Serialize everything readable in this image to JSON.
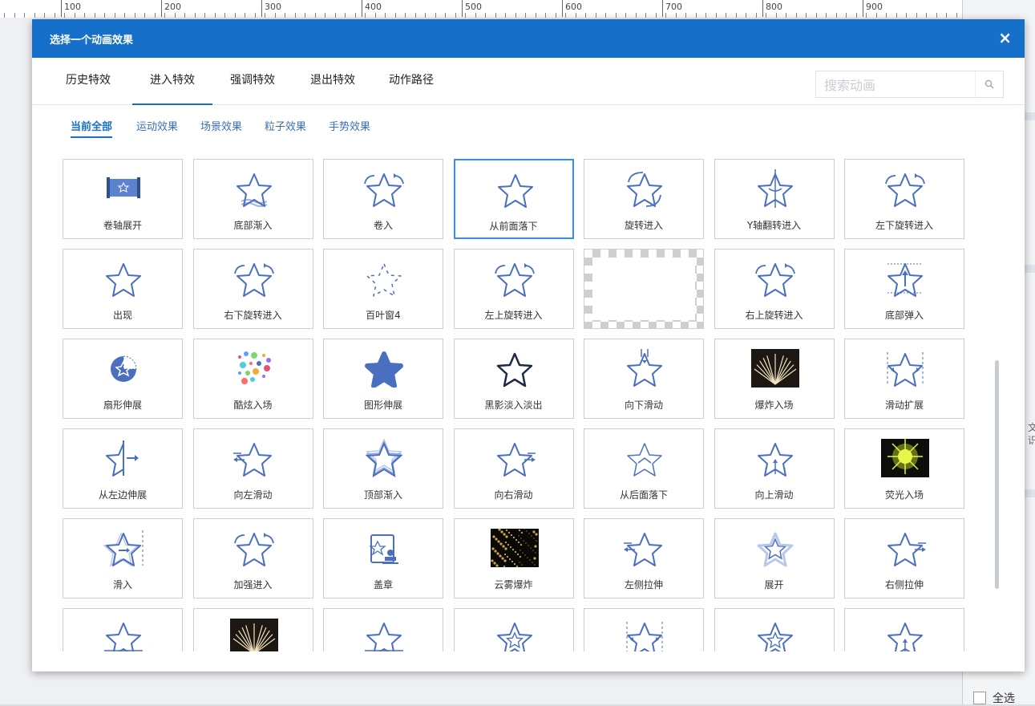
{
  "ruler": {
    "labels": [
      "100",
      "200",
      "300",
      "400",
      "500",
      "600",
      "700",
      "800",
      "900"
    ]
  },
  "background": {
    "select_all": "全选",
    "partial_1": "文",
    "partial_2": "识"
  },
  "dialog": {
    "title": "选择一个动画效果",
    "close_label": "×",
    "tabs": [
      {
        "label": "历史特效"
      },
      {
        "label": "进入特效",
        "active": true
      },
      {
        "label": "强调特效"
      },
      {
        "label": "退出特效"
      },
      {
        "label": "动作路径"
      }
    ],
    "search": {
      "placeholder": "搜索动画",
      "icon": "search-icon"
    },
    "subtabs": [
      {
        "label": "当前全部",
        "active": true
      },
      {
        "label": "运动效果"
      },
      {
        "label": "场景效果"
      },
      {
        "label": "粒子效果"
      },
      {
        "label": "手势效果"
      }
    ],
    "effects": [
      {
        "label": "卷轴展开",
        "icon": "scroll"
      },
      {
        "label": "底部渐入",
        "icon": "star-wave"
      },
      {
        "label": "卷入",
        "icon": "star-swirl"
      },
      {
        "label": "从前面落下",
        "icon": "star",
        "selected": true
      },
      {
        "label": "旋转进入",
        "icon": "star-rotate"
      },
      {
        "label": "Y轴翻转进入",
        "icon": "star-flip"
      },
      {
        "label": "左下旋转进入",
        "icon": "star-swirl"
      },
      {
        "label": "出现",
        "icon": "star"
      },
      {
        "label": "右下旋转进入",
        "icon": "star-swirl"
      },
      {
        "label": "百叶窗4",
        "icon": "star-dashed"
      },
      {
        "label": "左上旋转进入",
        "icon": "star-swirl"
      },
      {
        "label": "",
        "icon": "checker"
      },
      {
        "label": "右上旋转进入",
        "icon": "star-swirl"
      },
      {
        "label": "底部弹入",
        "icon": "star-bounce"
      },
      {
        "label": "扇形伸展",
        "icon": "pie"
      },
      {
        "label": "酷炫入场",
        "icon": "dots"
      },
      {
        "label": "图形伸展",
        "icon": "blob"
      },
      {
        "label": "黑影淡入淡出",
        "icon": "star-dark"
      },
      {
        "label": "向下滑动",
        "icon": "star-down"
      },
      {
        "label": "爆炸入场",
        "icon": "photo-burst"
      },
      {
        "label": "滑动扩展",
        "icon": "star-expand"
      },
      {
        "label": "从左边伸展",
        "icon": "star-half"
      },
      {
        "label": "向左滑动",
        "icon": "star-left"
      },
      {
        "label": "顶部渐入",
        "icon": "star-stack"
      },
      {
        "label": "向右滑动",
        "icon": "star-right"
      },
      {
        "label": "从后面落下",
        "icon": "star-thin"
      },
      {
        "label": "向上滑动",
        "icon": "star-up"
      },
      {
        "label": "荧光入场",
        "icon": "photo-glow"
      },
      {
        "label": "滑入",
        "icon": "star-slide"
      },
      {
        "label": "加强进入",
        "icon": "star-swirl"
      },
      {
        "label": "盖章",
        "icon": "stamp"
      },
      {
        "label": "云雾爆炸",
        "icon": "photo-dark"
      },
      {
        "label": "左侧拉伸",
        "icon": "star-left"
      },
      {
        "label": "展开",
        "icon": "star-double"
      },
      {
        "label": "右侧拉伸",
        "icon": "star-right"
      },
      {
        "label": "",
        "icon": "star-line"
      },
      {
        "label": "",
        "icon": "photo-burst"
      },
      {
        "label": "",
        "icon": "star-line"
      },
      {
        "label": "",
        "icon": "star-inner"
      },
      {
        "label": "",
        "icon": "star-expand"
      },
      {
        "label": "",
        "icon": "star-inner"
      },
      {
        "label": "",
        "icon": "star-up"
      }
    ]
  },
  "colors": {
    "accent": "#1670c9",
    "icon": "#4a6fbf",
    "selected_border": "#3b8fe0"
  }
}
